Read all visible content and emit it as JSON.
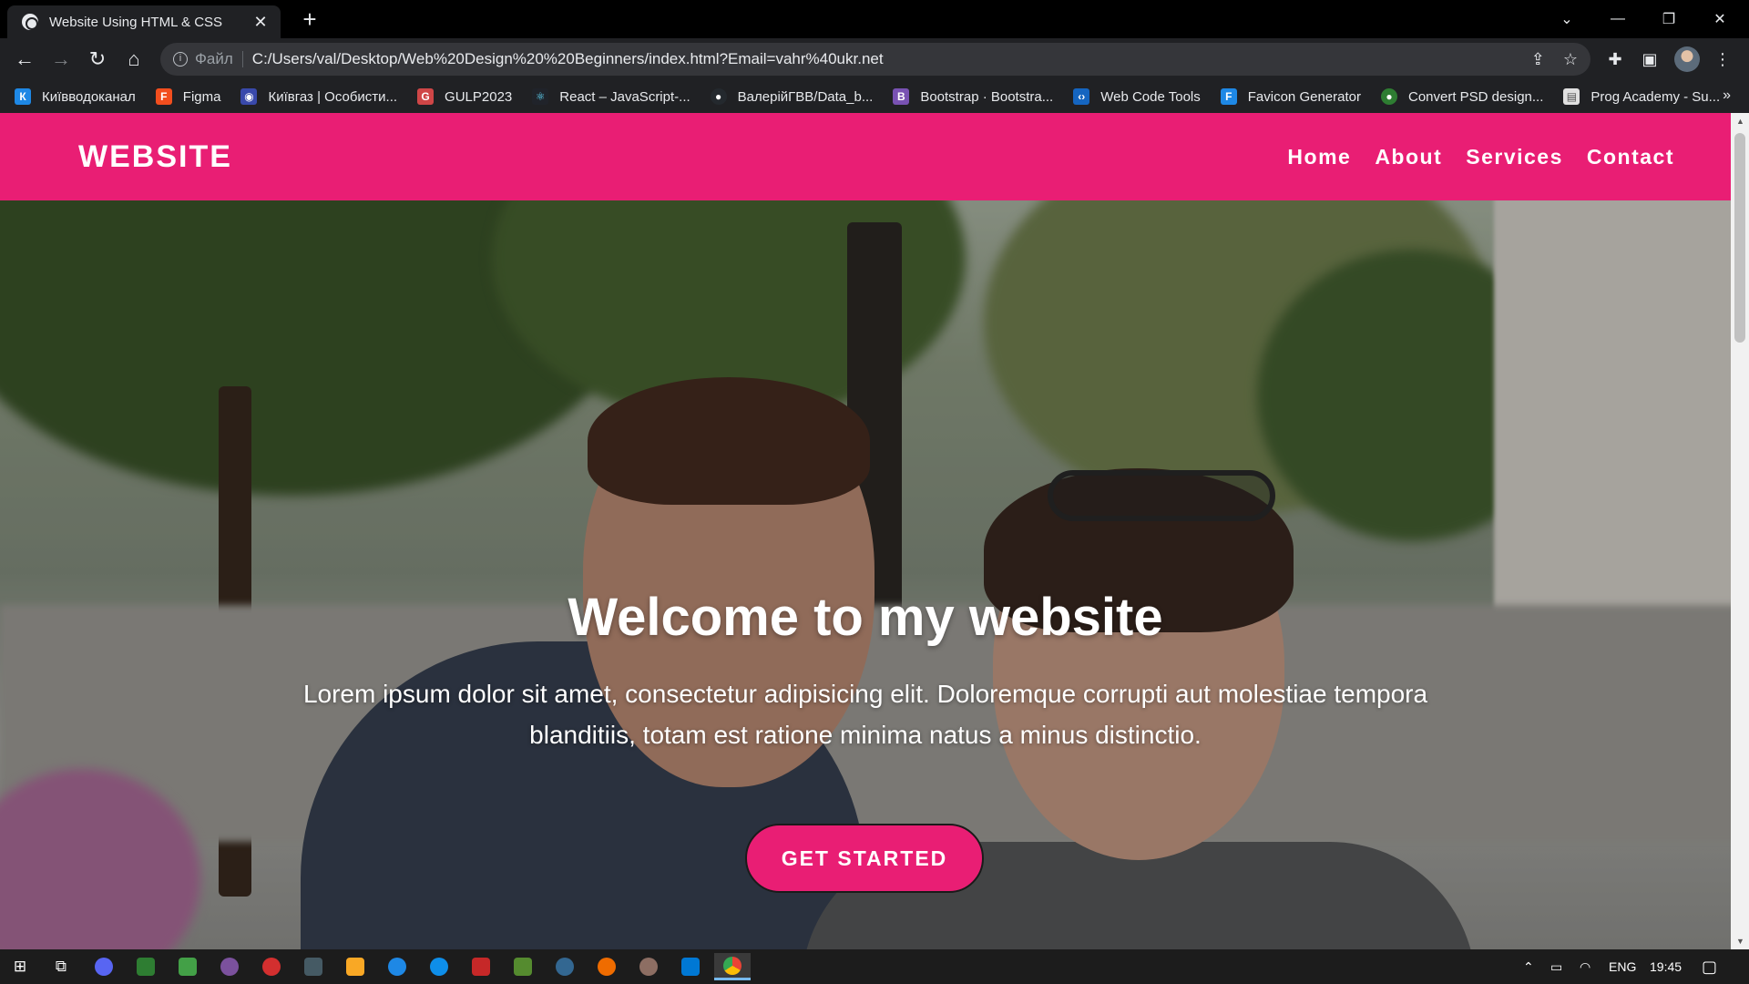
{
  "browser": {
    "tab_title": "Website Using HTML & CSS",
    "scheme_label": "Файл",
    "url": "C:/Users/val/Desktop/Web%20Design%20%20Beginners/index.html?Email=vahr%40ukr.net",
    "bookmarks": [
      {
        "label": "Київводоканал",
        "icon": "kv-icon",
        "color": "#1e88e5"
      },
      {
        "label": "Figma",
        "icon": "figma-icon",
        "color": "#f24e1e"
      },
      {
        "label": "Київгаз | Особисти...",
        "icon": "gas-icon",
        "color": "#3949ab"
      },
      {
        "label": "GULP2023",
        "icon": "gulp-icon",
        "color": "#cf4647"
      },
      {
        "label": "React – JavaScript-...",
        "icon": "react-icon",
        "color": "#61dafb"
      },
      {
        "label": "ВалерійГВВ/Data_b...",
        "icon": "github-icon",
        "color": "#24292e"
      },
      {
        "label": "Bootstrap · Bootstra...",
        "icon": "bootstrap-icon",
        "color": "#7952b3"
      },
      {
        "label": "Web Code Tools",
        "icon": "code-icon",
        "color": "#1565c0"
      },
      {
        "label": "Favicon Generator",
        "icon": "favicon-icon",
        "color": "#1e88e5"
      },
      {
        "label": "Convert PSD design...",
        "icon": "drop-icon",
        "color": "#2e7d32"
      },
      {
        "label": "Prog Academy - Su...",
        "icon": "page-icon",
        "color": "#e0e0e0"
      }
    ],
    "bookmarks_overflow": "»"
  },
  "site": {
    "logo": "WEBSITE",
    "nav": [
      "Home",
      "About",
      "Services",
      "Contact"
    ],
    "hero": {
      "title": "Welcome to my website",
      "text": "Lorem ipsum dolor sit amet, consectetur adipisicing elit. Doloremque corrupti aut molestiae tempora blanditiis, totam est ratione minima natus a minus distinctio.",
      "button": "GET STARTED"
    },
    "accent_color": "#e91e74"
  },
  "taskbar": {
    "language": "ENG",
    "time": "19:45"
  }
}
